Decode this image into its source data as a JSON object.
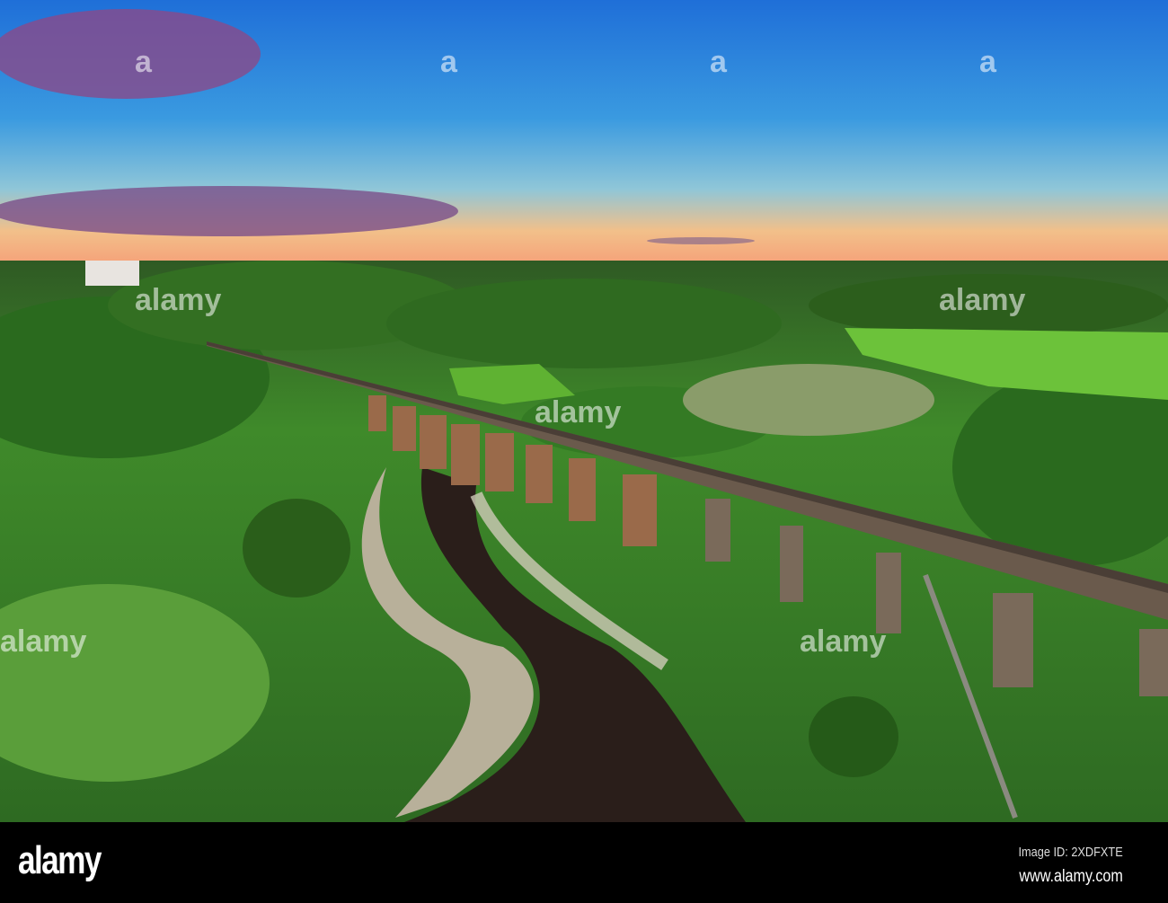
{
  "photo": {
    "subject": "Aerial view of railway viaduct over river at sunset",
    "watermark": "alamy"
  },
  "footer": {
    "logo": "alamy",
    "image_id": "Image ID: 2XDFXTE",
    "url": "www.alamy.com"
  }
}
